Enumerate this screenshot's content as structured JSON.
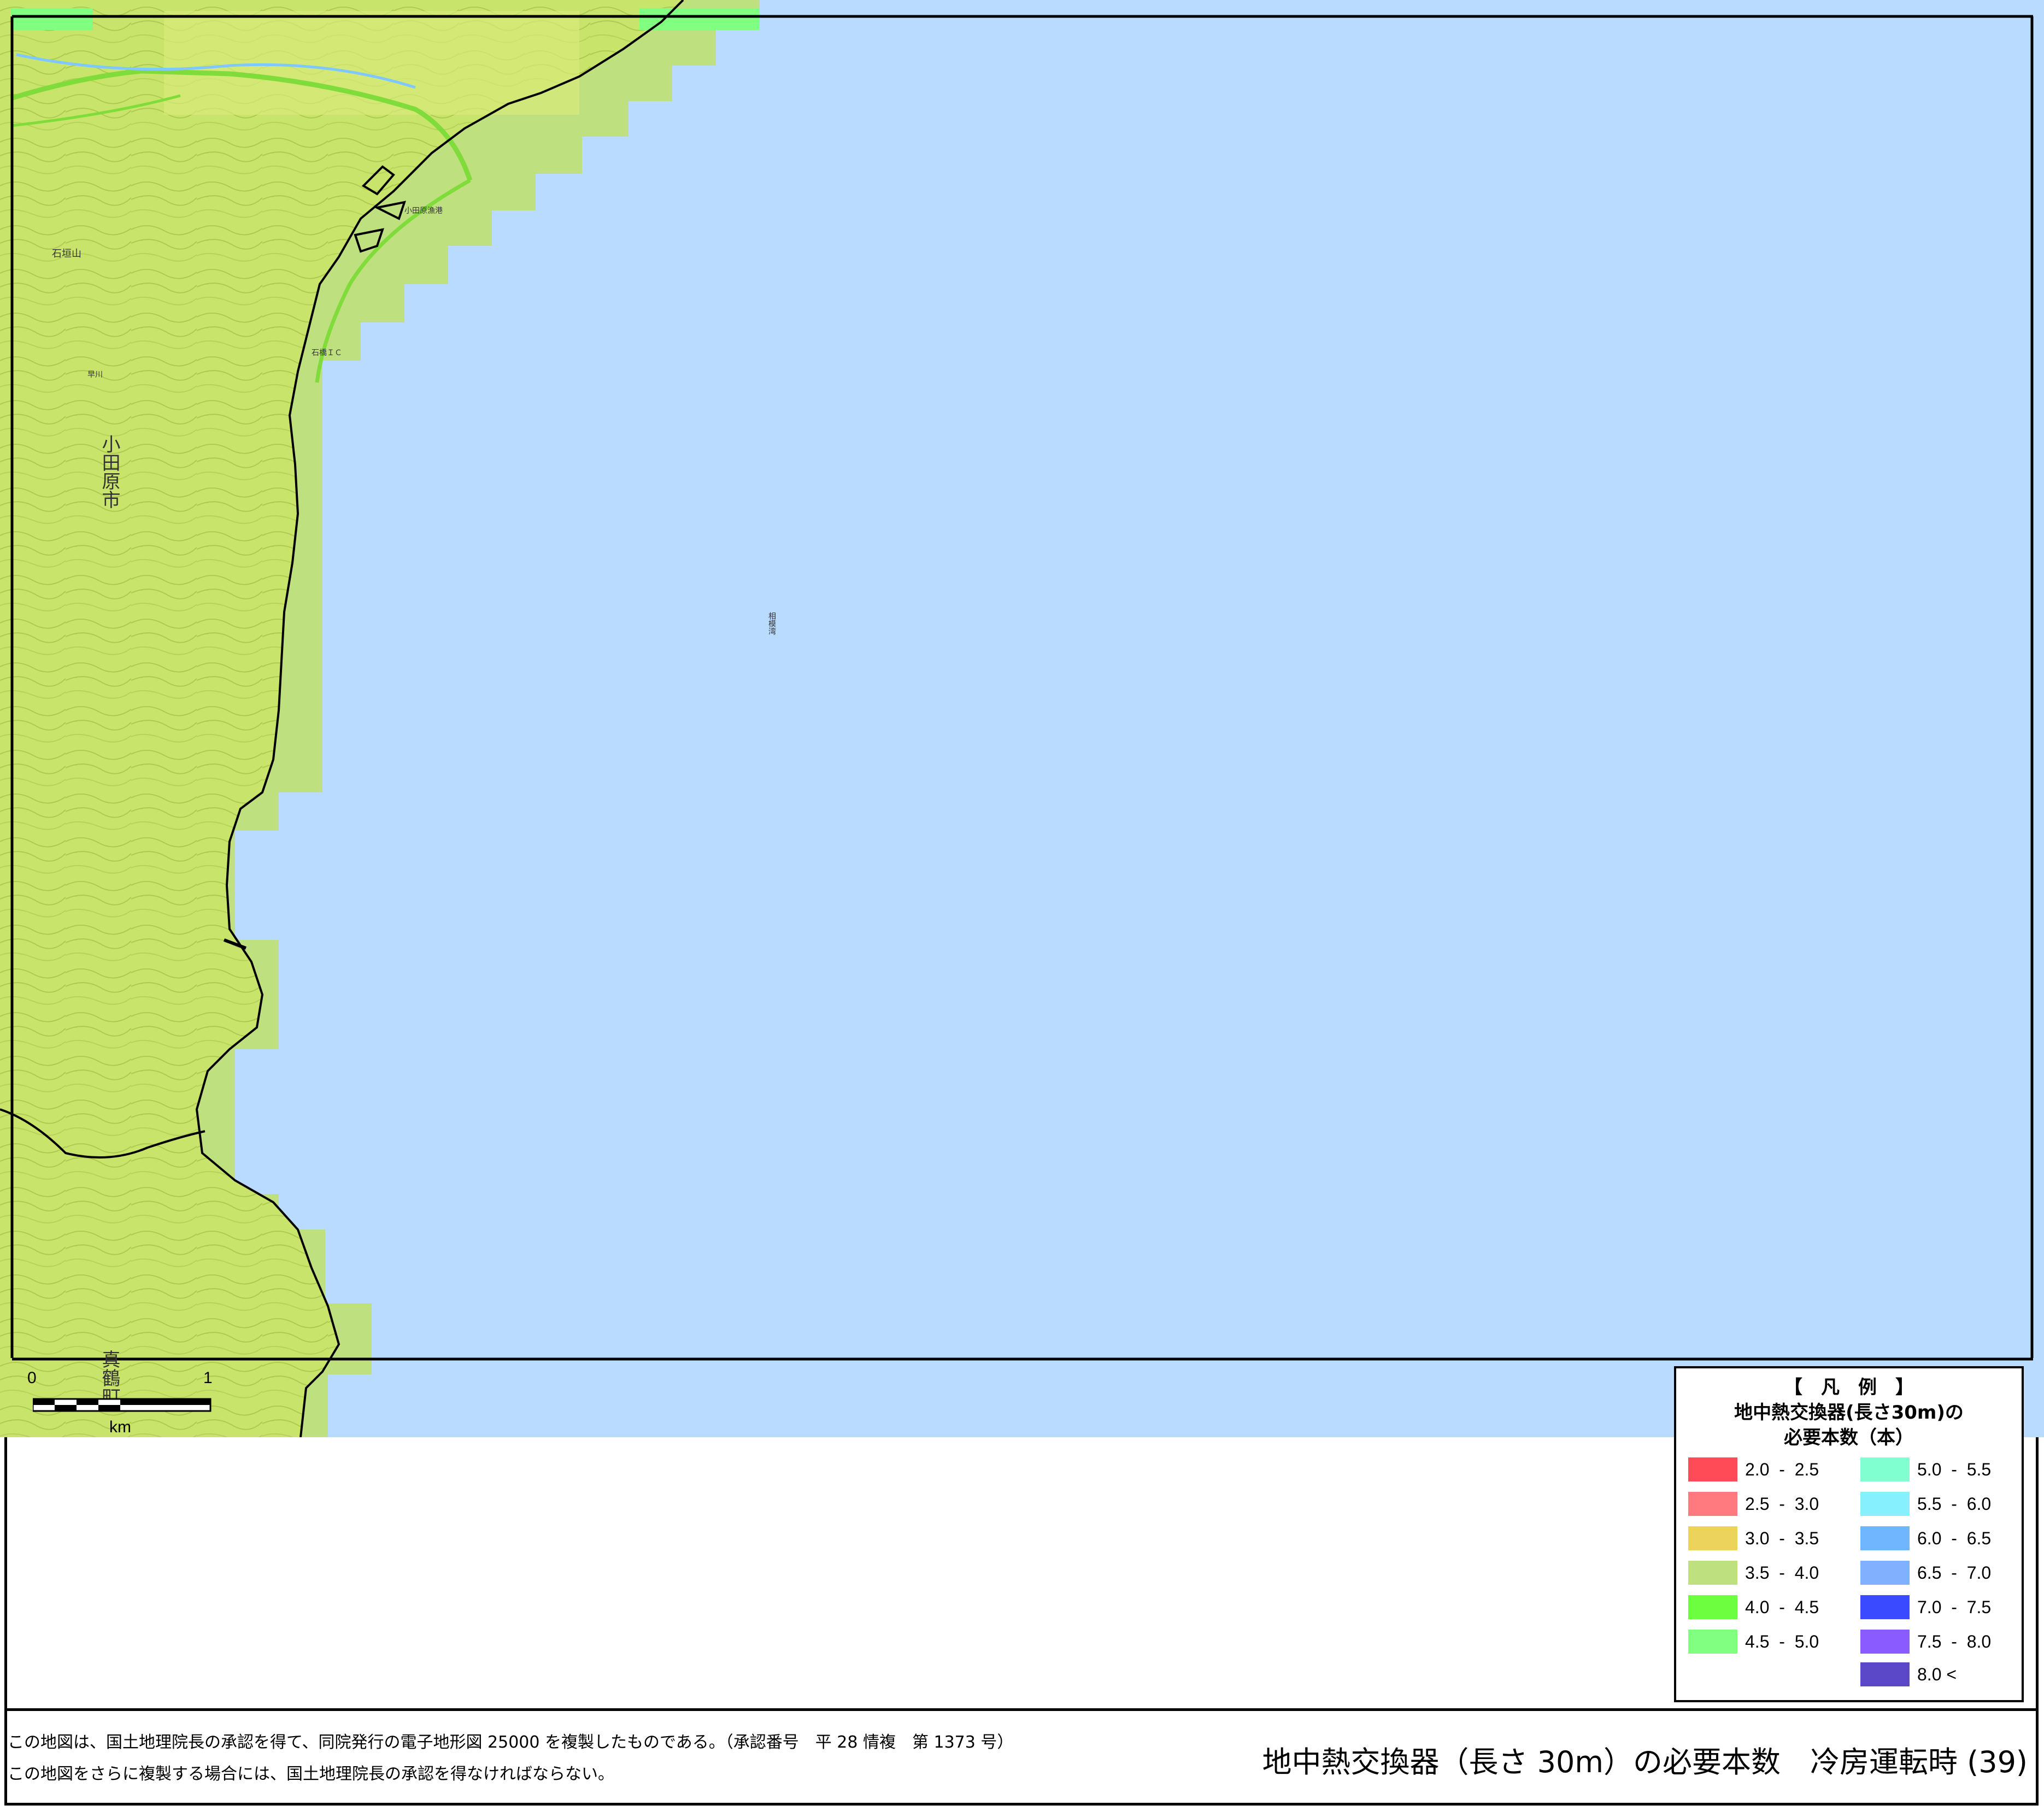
{
  "map": {
    "place_labels": {
      "city_odawara": "小田原市",
      "town_manazuru": "真鶴町",
      "sea_sagami": "相模湾",
      "mountain_ishigakiyama": "石垣山",
      "interchange": "石橋ＩＣ",
      "port_odawara": "小田原漁港",
      "river_hayakawa": "早川"
    },
    "colors": {
      "sea": "#b8dbff",
      "land": "#c9e46a",
      "class_3_5_4_0": "#bee07e",
      "class_4_5_5_0": "#80ff80",
      "road": "#7fdc3a",
      "coastline": "#000000"
    }
  },
  "scale": {
    "start": "0",
    "end": "1",
    "unit": "km"
  },
  "legend": {
    "header": "【　凡　例　】",
    "title": "地中熱交換器(長さ30m)の",
    "subtitle": "必要本数（本）",
    "items": [
      {
        "label": "2.0  -  2.5",
        "color": "#ff4a57"
      },
      {
        "label": "2.5  -  3.0",
        "color": "#ff7a7f"
      },
      {
        "label": "3.0  -  3.5",
        "color": "#ecd45c"
      },
      {
        "label": "3.5  -  4.0",
        "color": "#bee07e"
      },
      {
        "label": "4.0  -  4.5",
        "color": "#6dff3f"
      },
      {
        "label": "4.5  -  5.0",
        "color": "#80ff80"
      },
      {
        "label": "5.0  -  5.5",
        "color": "#80ffd0"
      },
      {
        "label": "5.5  -  6.0",
        "color": "#86f0ff"
      },
      {
        "label": "6.0  -  6.5",
        "color": "#6fb6ff"
      },
      {
        "label": "6.5  -  7.0",
        "color": "#80b0ff"
      },
      {
        "label": "7.0  -  7.5",
        "color": "#3a4bff"
      },
      {
        "label": "7.5  -  8.0",
        "color": "#8a5cff"
      },
      {
        "label": "8.0 <",
        "color": "#5a48c8"
      }
    ]
  },
  "footer": {
    "copyright_line1": "この地図は、国土地理院長の承認を得て、同院発行の電子地形図 25000 を複製したものである。（承認番号　平 28 情複　第 1373 号）",
    "copyright_line2": "この地図をさらに複製する場合には、国土地理院長の承認を得なければならない。",
    "title": "地中熱交換器（長さ 30m）の必要本数　冷房運転時 (39)"
  }
}
